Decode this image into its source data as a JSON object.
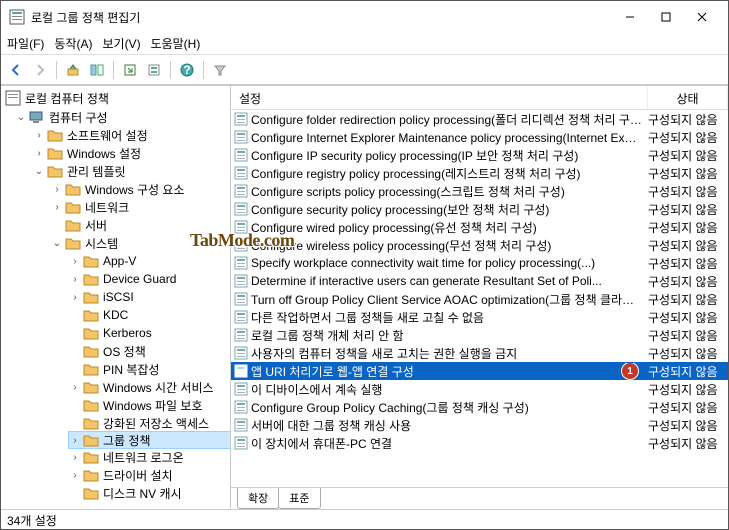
{
  "window": {
    "title": "로컬 그룹 정책 편집기"
  },
  "menus": {
    "file": "파일(F)",
    "action": "동작(A)",
    "view": "보기(V)",
    "help": "도움말(H)"
  },
  "tree": {
    "root": "로컬 컴퓨터 정책",
    "computer_config": "컴퓨터 구성",
    "software_settings": "소프트웨어 설정",
    "windows_settings": "Windows 설정",
    "admin_templates": "관리 템플릿",
    "windows_components": "Windows 구성 요소",
    "network": "네트워크",
    "server": "서버",
    "system": "시스템",
    "appv": "App-V",
    "device_guard": "Device Guard",
    "iscsi": "iSCSI",
    "kdc": "KDC",
    "kerberos": "Kerberos",
    "os_policies": "OS 정책",
    "pin_complexity": "PIN 복잡성",
    "windows_time_service": "Windows 시간 서비스",
    "windows_file_protection": "Windows 파일 보호",
    "enhanced_storage": "강화된 저장소 액세스",
    "group_policy": "그룹 정책",
    "net_logon": "네트워크 로그온",
    "driver_install": "드라이버 설치",
    "truncated": "디스크 NV 캐시"
  },
  "columns": {
    "setting": "설정",
    "state": "상태"
  },
  "state_label": "구성되지 않음",
  "rows": [
    {
      "label": "Configure folder redirection policy processing(폴더 리디렉션 정책 처리 구성)",
      "sel": false
    },
    {
      "label": "Configure Internet Explorer Maintenance policy processing(Internet Explorer 관리 정책 처리 구성)",
      "sel": false
    },
    {
      "label": "Configure IP security policy processing(IP 보안 정책 처리 구성)",
      "sel": false
    },
    {
      "label": "Configure registry policy processing(레지스트리 정책 처리 구성)",
      "sel": false
    },
    {
      "label": "Configure scripts policy processing(스크립트 정책 처리 구성)",
      "sel": false
    },
    {
      "label": "Configure security policy processing(보안 정책 처리 구성)",
      "sel": false
    },
    {
      "label": "Configure wired policy processing(유선 정책 처리 구성)",
      "sel": false
    },
    {
      "label": "Configure wireless policy processing(무선 정책 처리 구성)",
      "sel": false
    },
    {
      "label": "Specify workplace connectivity wait time for policy processing(...)",
      "sel": false
    },
    {
      "label": "Determine if interactive users can generate Resultant Set of Poli...",
      "sel": false
    },
    {
      "label": "Turn off Group Policy Client Service AOAC optimization(그룹 정책 클라이언트 서비스 AOAC 최적화 끄기)",
      "sel": false
    },
    {
      "label": "다른 작업하면서 그룹 정책들 새로 고칠 수 없음",
      "sel": false
    },
    {
      "label": "로컬 그룹 정책 개체 처리 안 함",
      "sel": false
    },
    {
      "label": "사용자의 컴퓨터 정책을 새로 고치는 권한 실행을 금지",
      "sel": false
    },
    {
      "label": "앱 URI 처리기로 웹-앱 연결 구성",
      "sel": true,
      "badge": "1"
    },
    {
      "label": "이 디바이스에서 계속 실행",
      "sel": false
    },
    {
      "label": "Configure Group Policy Caching(그룹 정책 캐싱 구성)",
      "sel": false
    },
    {
      "label": "서버에 대한 그룹 정책 캐싱 사용",
      "sel": false
    },
    {
      "label": "이 장치에서 휴대폰-PC 연결",
      "sel": false
    }
  ],
  "tabs": {
    "extended": "확장",
    "standard": "표준"
  },
  "status": "34개 설정",
  "watermark": "TabMode.com"
}
